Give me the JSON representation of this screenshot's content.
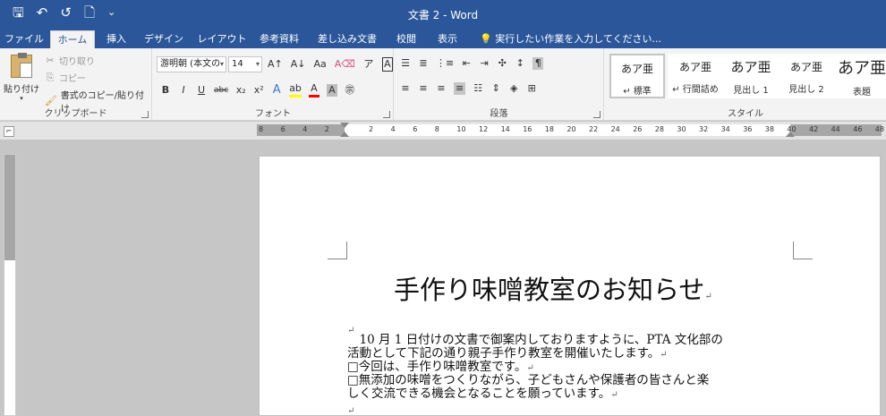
{
  "titlebar": {
    "title": "文書 2 - Word",
    "qat": [
      {
        "name": "save-icon",
        "glyph": "🖫"
      },
      {
        "name": "undo-icon",
        "glyph": "↶"
      },
      {
        "name": "redo-icon",
        "glyph": "↺"
      },
      {
        "name": "new-document-icon",
        "glyph": "🗋"
      },
      {
        "name": "customize-qat-icon",
        "glyph": "⌄"
      }
    ]
  },
  "tabs": [
    "ファイル",
    "ホーム",
    "挿入",
    "デザイン",
    "レイアウト",
    "参考資料",
    "差し込み文書",
    "校閲",
    "表示"
  ],
  "tell_me": "実行したい作業を入力してください...",
  "clipboard": {
    "paste": "貼り付け",
    "cut": "切り取り",
    "copy": "コピー",
    "format_painter": "書式のコピー/貼り付け",
    "label": "クリップボード"
  },
  "font": {
    "name": "游明朝 (本文の",
    "size": "14",
    "label": "フォント",
    "buttons_row1": [
      "A↑",
      "A↓",
      "Aa",
      "A⌫",
      "ア",
      "A"
    ],
    "buttons_row2": [
      "B",
      "I",
      "U",
      "abc",
      "x₂",
      "x²",
      "A",
      "ab",
      "A",
      "A",
      "㊪"
    ]
  },
  "paragraph": {
    "label": "段落"
  },
  "styles": {
    "label": "スタイル",
    "items": [
      {
        "sample": "あア亜",
        "name": "↵ 標準"
      },
      {
        "sample": "あア亜",
        "name": "↵ 行間詰め"
      },
      {
        "sample": "あア亜",
        "name": "見出し 1"
      },
      {
        "sample": "あア亜",
        "name": "見出し 2"
      },
      {
        "sample": "あア亜",
        "name": "表題"
      }
    ]
  },
  "ruler": {
    "ticks": [
      "8",
      "6",
      "4",
      "2",
      "",
      "2",
      "4",
      "6",
      "8",
      "10",
      "12",
      "14",
      "16",
      "18",
      "20",
      "22",
      "24",
      "26",
      "28",
      "30",
      "32",
      "34",
      "36",
      "38",
      "40",
      "42",
      "44",
      "46",
      "48"
    ]
  },
  "document": {
    "title": "手作り味噌教室のお知らせ",
    "lines": [
      "　10 月 1 日付けの文書で御案内しておりますように、PTA 文化部の",
      "活動として下記の通り親子手作り教室を開催いたします。",
      "□今回は、手作り味噌教室です。",
      "□無添加の味噌をつくりながら、子どもさんや保護者の皆さんと楽",
      "しく交流できる機会となることを願っています。"
    ],
    "return_mark": "↵"
  },
  "colors": {
    "brand": "#2b579a",
    "ribbon": "#f3f3f3",
    "highlight_yellow": "#ffff00",
    "font_red": "#ff0000"
  }
}
